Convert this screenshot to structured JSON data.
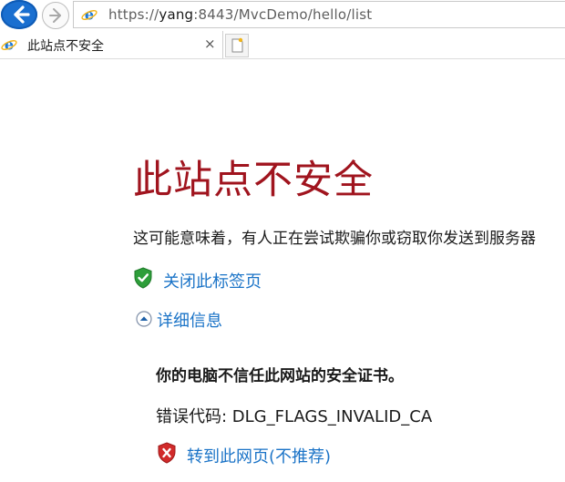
{
  "browser": {
    "address_bar": {
      "scheme": "https://",
      "host": "yang",
      "rest": ":8443/MvcDemo/hello/list"
    },
    "tab": {
      "title": "此站点不安全",
      "close_glyph": "×"
    },
    "icons": {
      "back": "back-arrow-icon",
      "forward": "forward-arrow-icon",
      "site": "ie-logo-icon",
      "new_tab": "new-tab-icon"
    }
  },
  "page": {
    "title": "此站点不安全",
    "description": "这可能意味着，有人正在尝试欺骗你或窃取你发送到服务器",
    "close_tab_link": "关闭此标签页",
    "details_toggle": "详细信息",
    "details": {
      "heading": "你的电脑不信任此网站的安全证书。",
      "error_code_label": "错误代码: ",
      "error_code": "DLG_FLAGS_INVALID_CA",
      "continue_link": "转到此网页(不推荐)"
    },
    "colors": {
      "title": "#a0141e",
      "link": "#1a73c7",
      "shield_green": "#2e9e3a",
      "shield_red": "#d12a2a"
    }
  }
}
